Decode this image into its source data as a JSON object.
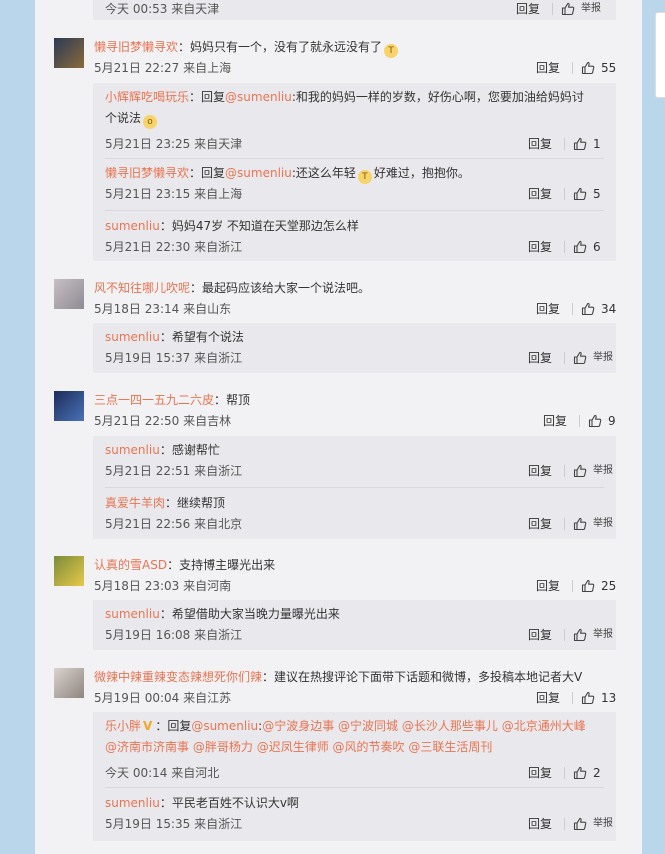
{
  "colors": {
    "page_bg": "#b9d6eb",
    "feed_bg": "#f2f2f5",
    "reply_bg": "#e9e9ed",
    "username": "#eb7350"
  },
  "icons": {
    "like": "thumbs-up-icon",
    "report": "report-icon",
    "crying_emoji": "crying-emoji-icon",
    "pleading_emoji": "pleading-emoji-icon",
    "verified": "v-badge-icon"
  },
  "actions": {
    "reply": "回复",
    "report": "举报"
  },
  "top_partial": {
    "meta": "今天 00:53 来自天津"
  },
  "comments": [
    {
      "user": "懒寻旧梦懒寻欢",
      "text": "：妈妈只有一个，没有了就永远没有了",
      "meta": "5月21日 22:27 来自上海",
      "likes": "55",
      "replies": [
        {
          "user": "小辉辉吃喝玩乐",
          "prefix": "：回复",
          "at": "@sumenliu",
          "text": ":和我的妈妈一样的岁数，好伤心啊，您要加油给妈妈讨个说法",
          "meta": "5月21日 23:25 来自天津",
          "likes": "1"
        },
        {
          "user": "懒寻旧梦懒寻欢",
          "prefix": "：回复",
          "at": "@sumenliu",
          "text": ":还这么年轻",
          "text2": "好难过，抱抱你。",
          "meta": "5月21日 23:15 来自上海",
          "likes": "5"
        },
        {
          "user": "sumenliu",
          "text": "：妈妈47岁 不知道在天堂那边怎么样",
          "meta": "5月21日 22:30 来自浙江",
          "likes": "6"
        }
      ]
    },
    {
      "user": "风不知往哪儿吹呢",
      "text": "：最起码应该给大家一个说法吧。",
      "meta": "5月18日 23:14 来自山东",
      "likes": "34",
      "replies": [
        {
          "user": "sumenliu",
          "text": "：希望有个说法",
          "meta": "5月19日 15:37 来自浙江"
        }
      ]
    },
    {
      "user": "三点一四一五九二六皮",
      "text": "：帮顶",
      "meta": "5月21日 22:50 来自吉林",
      "likes": "9",
      "replies": [
        {
          "user": "sumenliu",
          "text": "：感谢帮忙",
          "meta": "5月21日 22:51 来自浙江"
        },
        {
          "user": "真爱牛羊肉",
          "text": "：继续帮顶",
          "meta": "5月21日 22:56 来自北京"
        }
      ]
    },
    {
      "user": "认真的雪ASD",
      "text": "：支持博主曝光出来",
      "meta": "5月18日 23:03 来自河南",
      "likes": "25",
      "replies": [
        {
          "user": "sumenliu",
          "text": "：希望借助大家当晚力量曝光出来",
          "meta": "5月19日 16:08 来自浙江"
        }
      ]
    },
    {
      "user": "微辣中辣重辣变态辣想死你们辣",
      "text": "：建议在热搜评论下面带下话题和微博，多投稿本地记者大V",
      "meta": "5月19日 00:04 来自江苏",
      "likes": "13",
      "replies": [
        {
          "user": "乐小胖",
          "prefix": "：回复",
          "mentions": [
            "@sumenliu",
            ":",
            "@宁波身边事",
            "@宁波同城",
            "@长沙人那些事儿",
            "@北京通州大峰",
            "@济南市济南事",
            "@胖哥杨力",
            "@迟凤生律师",
            "@风的节奏吹",
            "@三联生活周刊"
          ],
          "meta": "今天 00:14 来自河北",
          "likes": "2"
        },
        {
          "user": "sumenliu",
          "text": "：平民老百姓不认识大v啊",
          "meta": "5月19日 15:35 来自浙江"
        }
      ]
    }
  ]
}
